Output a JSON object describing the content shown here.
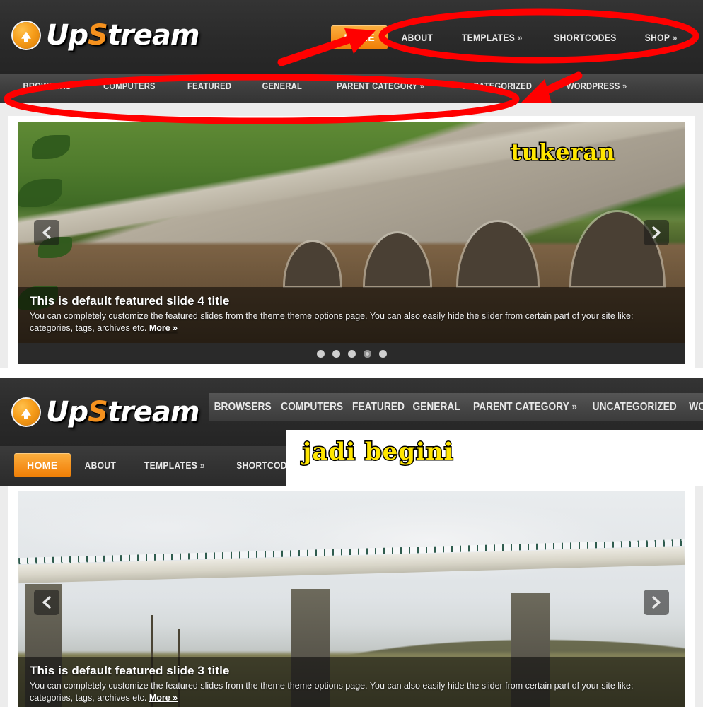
{
  "brand": {
    "name_part1": "Up",
    "name_highlight": "S",
    "name_part2": "tream",
    "accent_color": "#f5911e",
    "icon": "circle-up-arrow-icon"
  },
  "main_nav": [
    {
      "label": "HOME",
      "active": true
    },
    {
      "label": "ABOUT",
      "active": false
    },
    {
      "label": "TEMPLATES",
      "caret": "»",
      "active": false
    },
    {
      "label": "SHORTCODES",
      "active": false
    },
    {
      "label": "SHOP",
      "caret": "»",
      "active": false
    }
  ],
  "category_nav": [
    {
      "label": "BROWSERS"
    },
    {
      "label": "COMPUTERS"
    },
    {
      "label": "FEATURED"
    },
    {
      "label": "GENERAL"
    },
    {
      "label": "PARENT CATEGORY",
      "caret": "»"
    },
    {
      "label": "UNCATEGORIZED"
    },
    {
      "label": "WORDPRESS",
      "caret": "»"
    }
  ],
  "section_top": {
    "slider": {
      "prev_label": "‹",
      "next_label": "›",
      "caption_title": "This is default featured slide 4 title",
      "caption_body": "You can completely customize the featured slides from the theme theme options page. You can also easily hide the slider from certain part of your site like: categories, tags, archives etc.",
      "caption_more": "More »",
      "dots_total": 5,
      "dot_active_index": 4,
      "image_description": "stone arch bridge over muddy river with green trees"
    }
  },
  "section_bottom": {
    "slider": {
      "prev_label": "‹",
      "next_label": "›",
      "caption_title": "This is default featured slide 3 title",
      "caption_body": "You can completely customize the featured slides from the theme theme options page. You can also easily hide the slider from certain part of your site like: categories, tags, archives etc.",
      "caption_more": "More »",
      "image_description": "concrete viaduct bridge over hills under cloudy sky"
    }
  },
  "annotations": {
    "highlight_color": "#ff0000",
    "text_color": "#ffe600",
    "top_label": "tukeran",
    "bottom_label": "jadi begini",
    "ellipse_main_nav": "red ellipse around main navigation",
    "ellipse_category_nav": "red ellipse around category navigation",
    "arrow_to_main_nav": "red arrow pointing right at main navigation",
    "arrow_to_category_nav": "red arrow pointing down-left at category navigation"
  }
}
